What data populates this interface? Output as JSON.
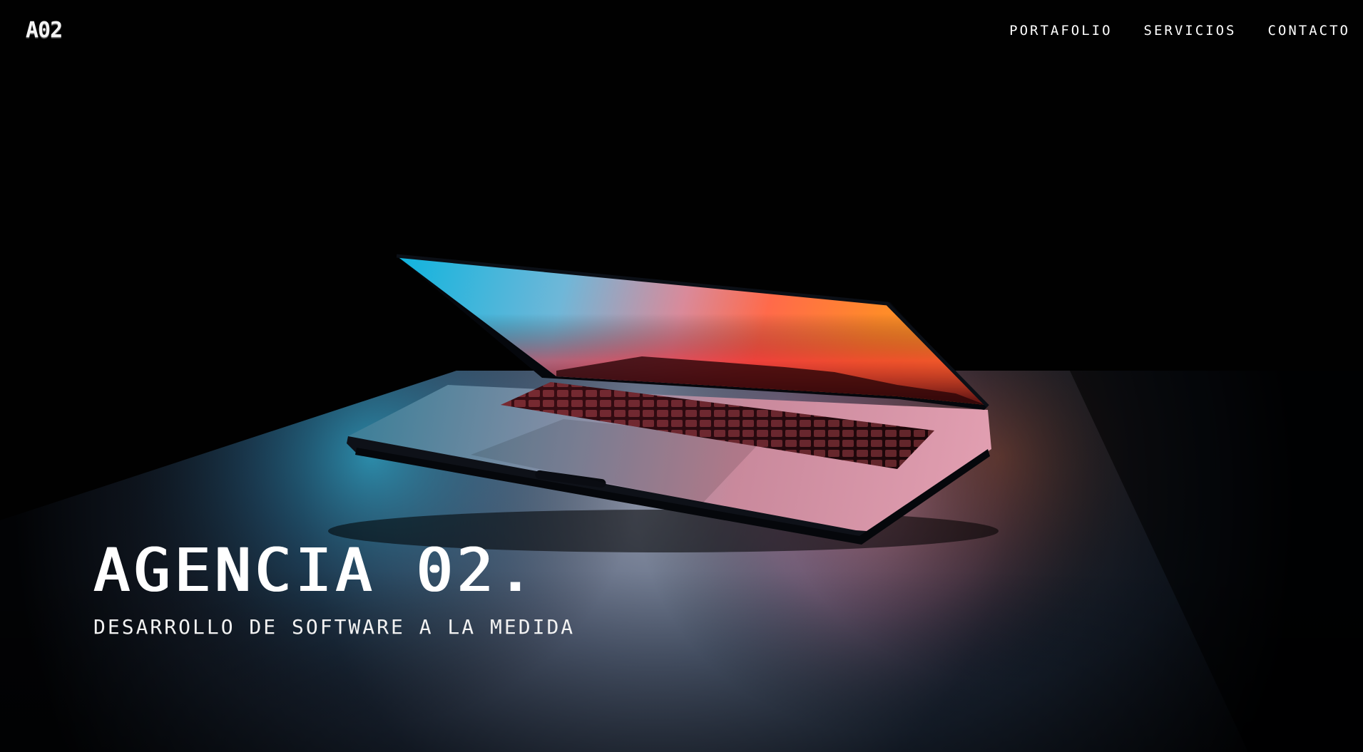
{
  "header": {
    "logo": "A02",
    "nav": [
      {
        "label": "PORTAFOLIO"
      },
      {
        "label": "SERVICIOS"
      },
      {
        "label": "CONTACTO"
      }
    ]
  },
  "hero": {
    "title": "AGENCIA 02.",
    "subtitle": "DESARROLLO DE SOFTWARE A LA MEDIDA",
    "image": "laptop-photo"
  },
  "colors": {
    "background": "#010101",
    "text": "#ffffff",
    "screen_cyan": "#10b4de",
    "screen_orange": "#ff6a1f",
    "screen_red": "#e1202e"
  }
}
